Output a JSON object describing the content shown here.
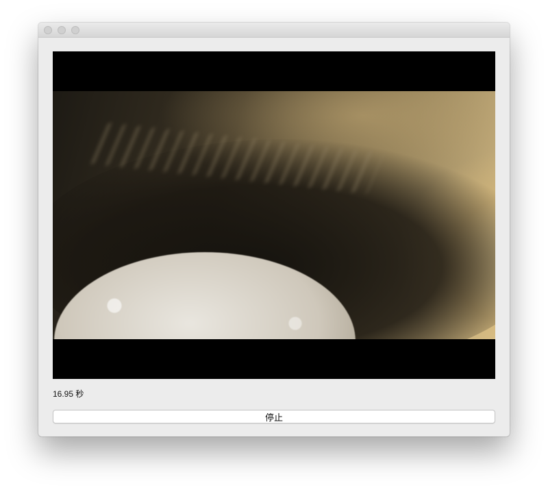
{
  "window": {
    "traffic_lights": [
      "close",
      "minimize",
      "zoom"
    ]
  },
  "video": {
    "elapsed_text": "16.95 秒"
  },
  "controls": {
    "stop_label": "停止"
  }
}
